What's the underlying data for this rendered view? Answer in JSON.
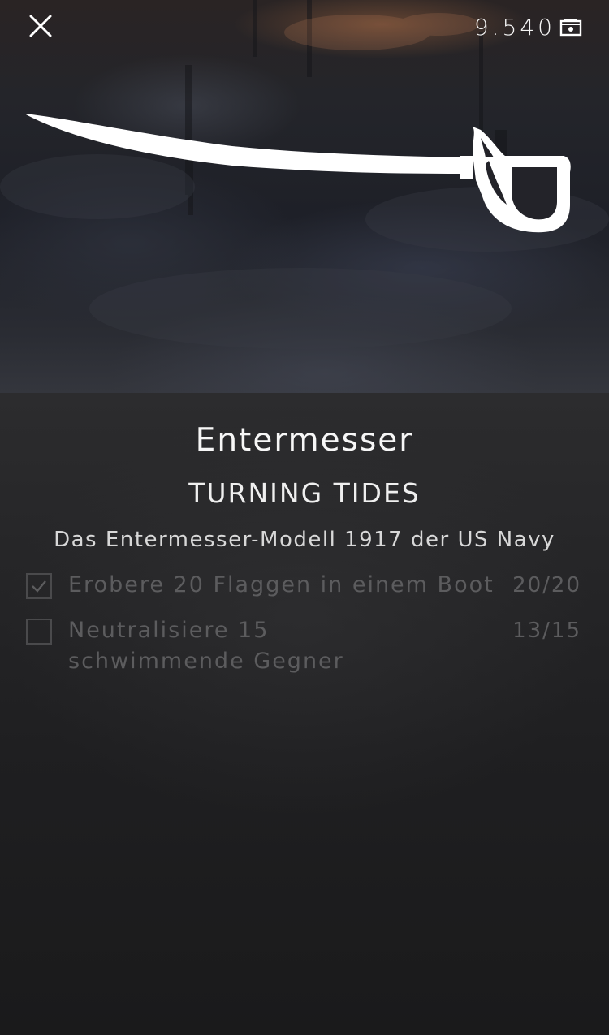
{
  "header": {
    "currency_value": "9.540",
    "currency_icon": "currency-chest-icon",
    "close_icon": "close-icon"
  },
  "item": {
    "image_icon": "cutlass-icon",
    "name": "Entermesser",
    "source": "TURNING TIDES",
    "description": "Das Entermesser-Modell 1917 der US Navy"
  },
  "tasks": [
    {
      "label": "Erobere 20 Flaggen in einem Boot",
      "progress": "20/20",
      "current": 20,
      "total": 20,
      "completed": true
    },
    {
      "label": "Neutralisiere 15 schwimmende Gegner",
      "progress": "13/15",
      "current": 13,
      "total": 15,
      "completed": false
    }
  ],
  "colors": {
    "text_primary": "#f7f7f7",
    "text_muted": "#5c5c5e",
    "panel_bg": "#262628"
  }
}
